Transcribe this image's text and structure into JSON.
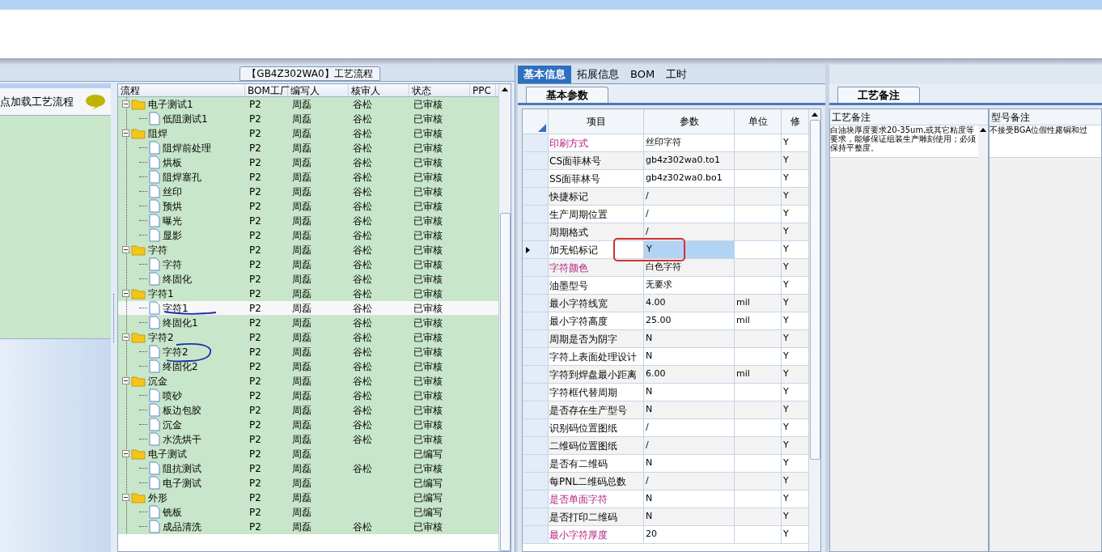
{
  "process_panel": {
    "title": "【GB4Z302WA0】工艺流程",
    "hint": "点加载工艺流程",
    "columns": [
      "流程",
      "BOM工厂",
      "编写人",
      "核审人",
      "状态",
      "PPC"
    ],
    "rows": [
      {
        "name": "电子测试1",
        "factory": "P2",
        "writer": "周磊",
        "reviewer": "谷松",
        "status": "已审核",
        "selected": false,
        "expanded": true,
        "children": [
          {
            "name": "低阻测试1",
            "factory": "P2",
            "writer": "周磊",
            "reviewer": "谷松",
            "status": "已审核",
            "selected": false
          }
        ]
      },
      {
        "name": "阻焊",
        "factory": "P2",
        "writer": "周磊",
        "reviewer": "谷松",
        "status": "已审核",
        "selected": false,
        "expanded": true,
        "children": [
          {
            "name": "阻焊前处理",
            "factory": "P2",
            "writer": "周磊",
            "reviewer": "谷松",
            "status": "已审核",
            "selected": false
          },
          {
            "name": "烘板",
            "factory": "P2",
            "writer": "周磊",
            "reviewer": "谷松",
            "status": "已审核",
            "selected": false
          },
          {
            "name": "阻焊塞孔",
            "factory": "P2",
            "writer": "周磊",
            "reviewer": "谷松",
            "status": "已审核",
            "selected": false
          },
          {
            "name": "丝印",
            "factory": "P2",
            "writer": "周磊",
            "reviewer": "谷松",
            "status": "已审核",
            "selected": false
          },
          {
            "name": "预烘",
            "factory": "P2",
            "writer": "周磊",
            "reviewer": "谷松",
            "status": "已审核",
            "selected": false
          },
          {
            "name": "曝光",
            "factory": "P2",
            "writer": "周磊",
            "reviewer": "谷松",
            "status": "已审核",
            "selected": false
          },
          {
            "name": "显影",
            "factory": "P2",
            "writer": "周磊",
            "reviewer": "谷松",
            "status": "已审核",
            "selected": false
          }
        ]
      },
      {
        "name": "字符",
        "factory": "P2",
        "writer": "周磊",
        "reviewer": "谷松",
        "status": "已审核",
        "selected": false,
        "expanded": true,
        "children": [
          {
            "name": "字符",
            "factory": "P2",
            "writer": "周磊",
            "reviewer": "谷松",
            "status": "已审核",
            "selected": false
          },
          {
            "name": "终固化",
            "factory": "P2",
            "writer": "周磊",
            "reviewer": "谷松",
            "status": "已审核",
            "selected": false
          }
        ]
      },
      {
        "name": "字符1",
        "factory": "P2",
        "writer": "周磊",
        "reviewer": "谷松",
        "status": "已审核",
        "selected": false,
        "expanded": true,
        "children": [
          {
            "name": "字符1",
            "factory": "P2",
            "writer": "周磊",
            "reviewer": "谷松",
            "status": "已审核",
            "selected": true
          },
          {
            "name": "终固化1",
            "factory": "P2",
            "writer": "周磊",
            "reviewer": "谷松",
            "status": "已审核",
            "selected": false
          }
        ]
      },
      {
        "name": "字符2",
        "factory": "P2",
        "writer": "周磊",
        "reviewer": "谷松",
        "status": "已审核",
        "selected": false,
        "expanded": true,
        "children": [
          {
            "name": "字符2",
            "factory": "P2",
            "writer": "周磊",
            "reviewer": "谷松",
            "status": "已审核",
            "selected": false
          },
          {
            "name": "终固化2",
            "factory": "P2",
            "writer": "周磊",
            "reviewer": "谷松",
            "status": "已审核",
            "selected": false
          }
        ]
      },
      {
        "name": "沉金",
        "factory": "P2",
        "writer": "周磊",
        "reviewer": "谷松",
        "status": "已审核",
        "selected": false,
        "expanded": true,
        "children": [
          {
            "name": "喷砂",
            "factory": "P2",
            "writer": "周磊",
            "reviewer": "谷松",
            "status": "已审核",
            "selected": false
          },
          {
            "name": "板边包胶",
            "factory": "P2",
            "writer": "周磊",
            "reviewer": "谷松",
            "status": "已审核",
            "selected": false
          },
          {
            "name": "沉金",
            "factory": "P2",
            "writer": "周磊",
            "reviewer": "谷松",
            "status": "已审核",
            "selected": false
          },
          {
            "name": "水洗烘干",
            "factory": "P2",
            "writer": "周磊",
            "reviewer": "谷松",
            "status": "已审核",
            "selected": false
          }
        ]
      },
      {
        "name": "电子测试",
        "factory": "P2",
        "writer": "周磊",
        "status": "已编写",
        "selected": false,
        "expanded": true,
        "children": [
          {
            "name": "阻抗测试",
            "factory": "P2",
            "writer": "周磊",
            "reviewer": "谷松",
            "status": "已审核",
            "selected": false
          },
          {
            "name": "电子测试",
            "factory": "P2",
            "writer": "周磊",
            "status": "已编写",
            "selected": false
          }
        ]
      },
      {
        "name": "外形",
        "factory": "P2",
        "writer": "周磊",
        "status": "已编写",
        "selected": false,
        "expanded": true,
        "children": [
          {
            "name": "铣板",
            "factory": "P2",
            "writer": "周磊",
            "status": "已编写",
            "selected": false
          },
          {
            "name": "成品清洗",
            "factory": "P2",
            "writer": "周磊",
            "reviewer": "谷松",
            "status": "已审核",
            "selected": false
          }
        ]
      }
    ]
  },
  "detail_panel": {
    "tabs": [
      {
        "label": "基本信息",
        "selected": true
      },
      {
        "label": "拓展信息",
        "selected": false
      },
      {
        "label": "BOM",
        "selected": false
      },
      {
        "label": "工时",
        "selected": false
      }
    ],
    "subtab": "基本参数",
    "columns": [
      "项目",
      "参数",
      "单位",
      "修"
    ],
    "rows": [
      {
        "item": "印刷方式",
        "value": "丝印字符",
        "flag": "Y",
        "emphasis": true,
        "selected": false
      },
      {
        "item": "CS面菲林号",
        "value": "gb4z302wa0.to1",
        "flag": "Y",
        "emphasis": false,
        "selected": false
      },
      {
        "item": "SS面菲林号",
        "value": "gb4z302wa0.bo1",
        "flag": "Y",
        "emphasis": false,
        "selected": false
      },
      {
        "item": "快捷标记",
        "value": "/",
        "flag": "Y",
        "emphasis": false,
        "selected": false
      },
      {
        "item": "生产周期位置",
        "value": "/",
        "flag": "Y",
        "emphasis": false,
        "selected": false
      },
      {
        "item": "周期格式",
        "value": "/",
        "flag": "Y",
        "emphasis": false,
        "selected": false
      },
      {
        "item": "加无铅标记",
        "value": "Y",
        "flag": "Y",
        "emphasis": false,
        "selected": true
      },
      {
        "item": "字符颜色",
        "value": "白色字符",
        "flag": "Y",
        "emphasis": true,
        "selected": false
      },
      {
        "item": "油墨型号",
        "value": "无要求",
        "flag": "Y",
        "emphasis": false,
        "selected": false
      },
      {
        "item": "最小字符线宽",
        "value": "4.00",
        "unit": "mil",
        "flag": "Y",
        "emphasis": false,
        "selected": false
      },
      {
        "item": "最小字符高度",
        "value": "25.00",
        "unit": "mil",
        "flag": "Y",
        "emphasis": false,
        "selected": false
      },
      {
        "item": "周期是否为阴字",
        "value": "N",
        "flag": "Y",
        "emphasis": false,
        "selected": false
      },
      {
        "item": "字符上表面处理设计",
        "value": "N",
        "flag": "Y",
        "emphasis": false,
        "selected": false
      },
      {
        "item": "字符到焊盘最小距离",
        "value": "6.00",
        "unit": "mil",
        "flag": "Y",
        "emphasis": false,
        "selected": false
      },
      {
        "item": "字符框代替周期",
        "value": "N",
        "flag": "Y",
        "emphasis": false,
        "selected": false
      },
      {
        "item": "是否存在生产型号",
        "value": "N",
        "flag": "Y",
        "emphasis": false,
        "selected": false
      },
      {
        "item": "识别码位置图纸",
        "value": "/",
        "flag": "Y",
        "emphasis": false,
        "selected": false
      },
      {
        "item": "二维码位置图纸",
        "value": "/",
        "flag": "Y",
        "emphasis": false,
        "selected": false
      },
      {
        "item": "是否有二维码",
        "value": "N",
        "flag": "Y",
        "emphasis": false,
        "selected": false
      },
      {
        "item": "每PNL二维码总数",
        "value": "/",
        "flag": "Y",
        "emphasis": false,
        "selected": false
      },
      {
        "item": "是否单面字符",
        "value": "N",
        "flag": "Y",
        "emphasis": true,
        "selected": false
      },
      {
        "item": "是否打印二维码",
        "value": "N",
        "flag": "Y",
        "emphasis": false,
        "selected": false
      },
      {
        "item": "最小字符厚度",
        "value": "20",
        "flag": "Y",
        "emphasis": true,
        "selected": false
      }
    ]
  },
  "notes_panel": {
    "tab": "工艺备注",
    "columns": [
      "工艺备注",
      "型号备注"
    ],
    "cells": [
      "白油块厚度要求20-35um,或其它粘度等要求，能够保证组装生产雕刻使用；必须保持平整度。",
      "不接受BGA位假性露铜和过"
    ]
  }
}
